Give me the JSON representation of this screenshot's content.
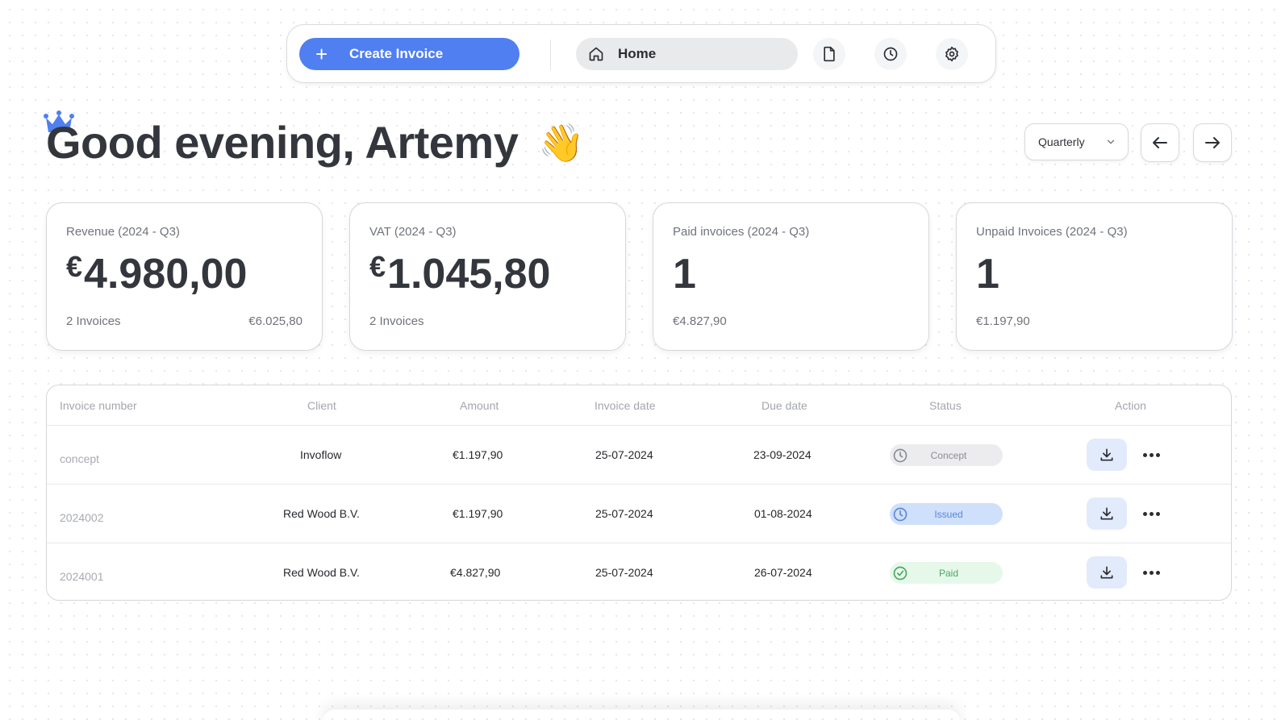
{
  "nav": {
    "create_label": "Create Invoice",
    "home_label": "Home",
    "icons": [
      "document-icon",
      "clock-icon",
      "gear-icon"
    ],
    "accent": "#4f7ff0"
  },
  "greeting": {
    "text": "Good evening, Artemy",
    "emoji": "👋",
    "crown_color": "#4f7ff0"
  },
  "period": {
    "selected": "Quarterly"
  },
  "cards": [
    {
      "title": "Revenue (2024 - Q3)",
      "currency": "€",
      "value": "4.980,00",
      "foot_left": "2 Invoices",
      "foot_right": "€6.025,80"
    },
    {
      "title": "VAT (2024 - Q3)",
      "currency": "€",
      "value": "1.045,80",
      "foot_left": "2 Invoices",
      "foot_right": ""
    },
    {
      "title": "Paid invoices (2024 - Q3)",
      "currency": "",
      "value": "1",
      "foot_left": "€4.827,90",
      "foot_right": ""
    },
    {
      "title": "Unpaid Invoices (2024 - Q3)",
      "currency": "",
      "value": "1",
      "foot_left": "€1.197,90",
      "foot_right": ""
    }
  ],
  "table": {
    "headers": {
      "number": "Invoice number",
      "client": "Client",
      "amount": "Amount",
      "invoice_date": "Invoice date",
      "due_date": "Due date",
      "status": "Status",
      "action": "Action"
    },
    "rows": [
      {
        "number": "concept",
        "client": "Invoflow",
        "amount": "€1.197,90",
        "invoice_date": "25-07-2024",
        "due_date": "23-09-2024",
        "status": "Concept"
      },
      {
        "number": "2024002",
        "client": "Red Wood B.V.",
        "amount": "€1.197,90",
        "invoice_date": "25-07-2024",
        "due_date": "01-08-2024",
        "status": "Issued"
      },
      {
        "number": "2024001",
        "client": "Red Wood B.V.",
        "amount": "€4.827,90",
        "invoice_date": "25-07-2024",
        "due_date": "26-07-2024",
        "status": "Paid"
      }
    ],
    "status_colors": {
      "Concept": {
        "bg": "#ececee",
        "fg": "#8a8d93"
      },
      "Issued": {
        "bg": "#cfe0fb",
        "fg": "#5d85d8"
      },
      "Paid": {
        "bg": "#e6f8ea",
        "fg": "#4aa763"
      }
    }
  }
}
